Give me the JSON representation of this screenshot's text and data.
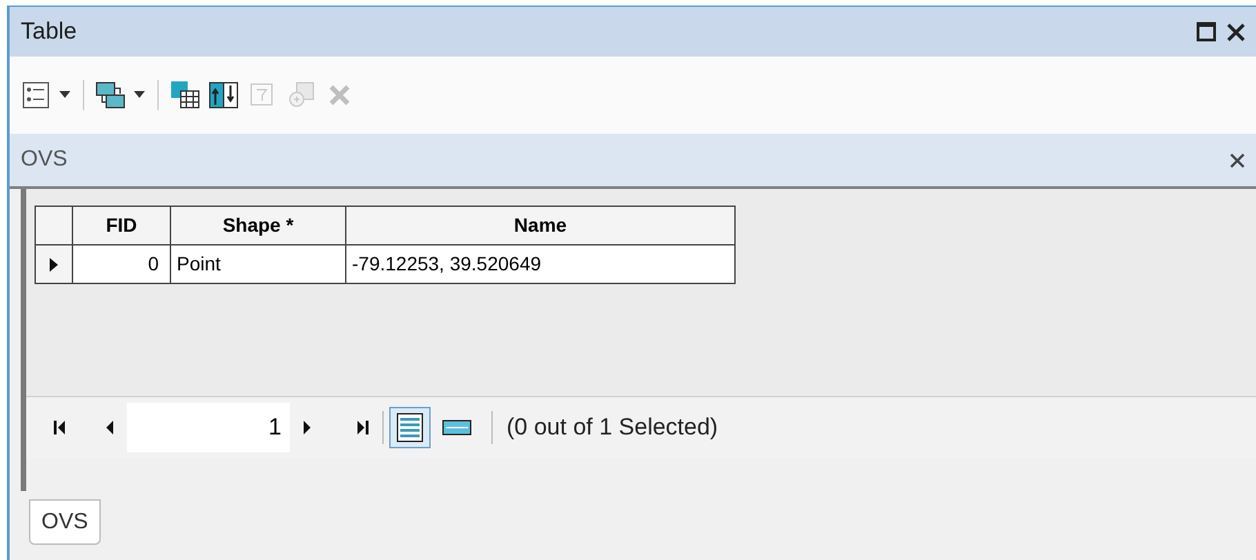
{
  "window": {
    "title": "Table"
  },
  "toolbar": [
    {
      "kind": "options",
      "dropdown": true,
      "disabled": false
    },
    {
      "kind": "related",
      "dropdown": true,
      "disabled": false
    },
    {
      "kind": "select",
      "dropdown": false,
      "disabled": false
    },
    {
      "kind": "switch",
      "dropdown": false,
      "disabled": false
    },
    {
      "kind": "clear",
      "dropdown": false,
      "disabled": true
    },
    {
      "kind": "zoom",
      "dropdown": false,
      "disabled": true
    },
    {
      "kind": "delete",
      "dropdown": false,
      "disabled": true
    }
  ],
  "table_title": "OVS",
  "table": {
    "columns": [
      "FID",
      "Shape *",
      "Name"
    ],
    "rows": [
      {
        "current": true,
        "cells": [
          "0",
          "Point",
          "-79.12253, 39.520649"
        ]
      }
    ]
  },
  "navigator": {
    "record": "1",
    "views": [
      {
        "kind": "all",
        "selected": true
      },
      {
        "kind": "selected",
        "selected": false
      }
    ],
    "status": "(0 out of 1 Selected)"
  },
  "tabs": [
    {
      "label": "OVS",
      "selected": true
    }
  ]
}
